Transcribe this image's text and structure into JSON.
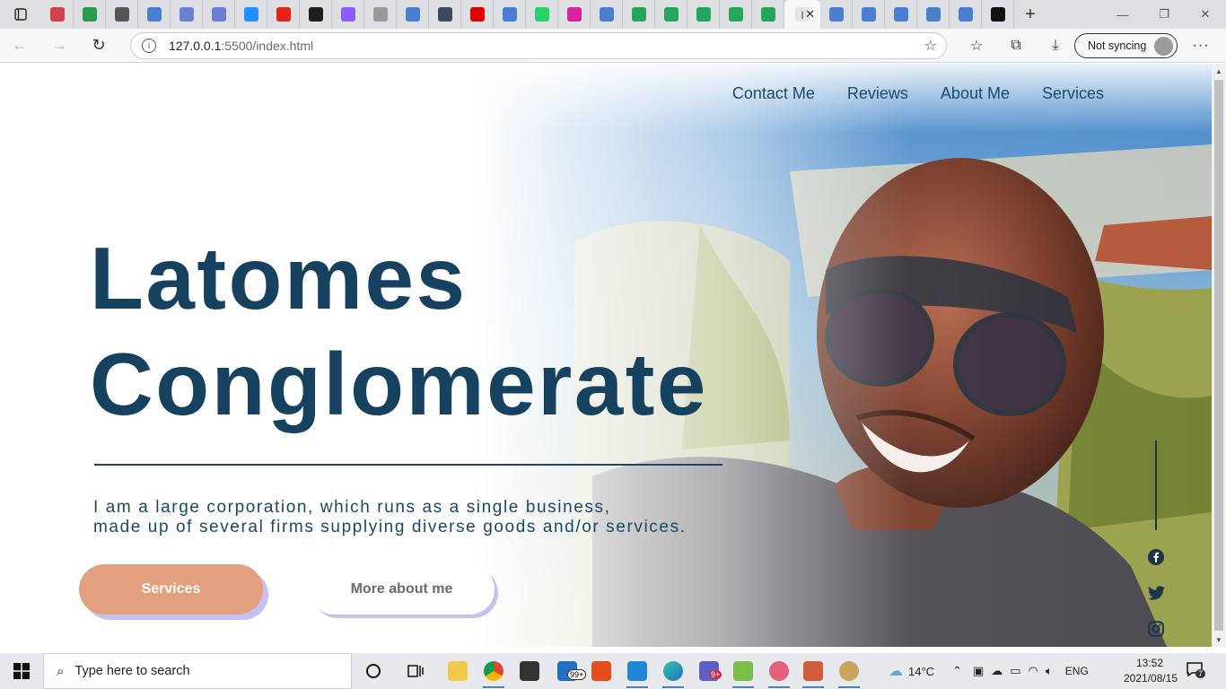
{
  "browser": {
    "url_host": "127.0.0.1",
    "url_path": ":5500/index.html",
    "profile_label": "Not syncing",
    "tabs": [
      {
        "icon": "app-icon",
        "color": "#c44"
      },
      {
        "icon": "drive-icon",
        "color": "#2a9d4a"
      },
      {
        "icon": "github-icon",
        "color": "#555"
      },
      {
        "icon": "bing-icon",
        "color": "#4a7fd0"
      },
      {
        "icon": "circle-icon",
        "color": "#6c7fd6"
      },
      {
        "icon": "circle-icon",
        "color": "#6c7fd6"
      },
      {
        "icon": "chat-icon",
        "color": "#1e90ff"
      },
      {
        "icon": "youtube-icon",
        "color": "#e62117"
      },
      {
        "icon": "edge-icon",
        "color": "#1d1d1d"
      },
      {
        "icon": "figma-icon",
        "color": "#8b5cf6"
      },
      {
        "icon": "wix-icon",
        "color": "#999"
      },
      {
        "icon": "bing-icon",
        "color": "#4a7fd0"
      },
      {
        "icon": "dg-icon",
        "color": "#3b4a5e"
      },
      {
        "icon": "netflix-icon",
        "color": "#d00"
      },
      {
        "icon": "bing-icon",
        "color": "#4a7fd0"
      },
      {
        "icon": "whatsapp-icon",
        "color": "#25d366"
      },
      {
        "icon": "instagram-icon",
        "color": "#d6249f"
      },
      {
        "icon": "bing-icon",
        "color": "#4a7fd0"
      },
      {
        "icon": "w-icon",
        "color": "#26a65b"
      },
      {
        "icon": "w-icon",
        "color": "#26a65b"
      },
      {
        "icon": "w-icon",
        "color": "#26a65b"
      },
      {
        "icon": "w-icon",
        "color": "#26a65b"
      },
      {
        "icon": "w-icon",
        "color": "#26a65b"
      }
    ],
    "tabs_after": [
      {
        "icon": "bing-icon",
        "color": "#4a7fd0"
      },
      {
        "icon": "bing-icon",
        "color": "#4a7fd0"
      },
      {
        "icon": "bing-icon",
        "color": "#4a7fd0"
      },
      {
        "icon": "bing-icon",
        "color": "#4a7fd0"
      },
      {
        "icon": "bing-icon",
        "color": "#4a7fd0"
      },
      {
        "icon": "notion-icon",
        "color": "#111"
      }
    ]
  },
  "page": {
    "nav": [
      "Contact Me",
      "Reviews",
      "About Me",
      "Services"
    ],
    "title_line1": "Latomes",
    "title_line2": "Conglomerate",
    "description_line1": "I am a large corporation, which runs as a single business,",
    "description_line2": "made up of several firms supplying diverse goods and/or services.",
    "primary_button": "Services",
    "secondary_button": "More about me",
    "social": [
      "facebook-icon",
      "twitter-icon",
      "instagram-icon"
    ],
    "colors": {
      "heading": "#17425f",
      "accent_button": "#e2a07f",
      "button_shadow": "#c8bff3"
    }
  },
  "taskbar": {
    "search_placeholder": "Type here to search",
    "weather": "14°C",
    "language": "ENG",
    "time": "13:52",
    "date": "2021/08/15",
    "mail_badge": "99+",
    "teams_badge": "9+",
    "notification_count": "7"
  }
}
